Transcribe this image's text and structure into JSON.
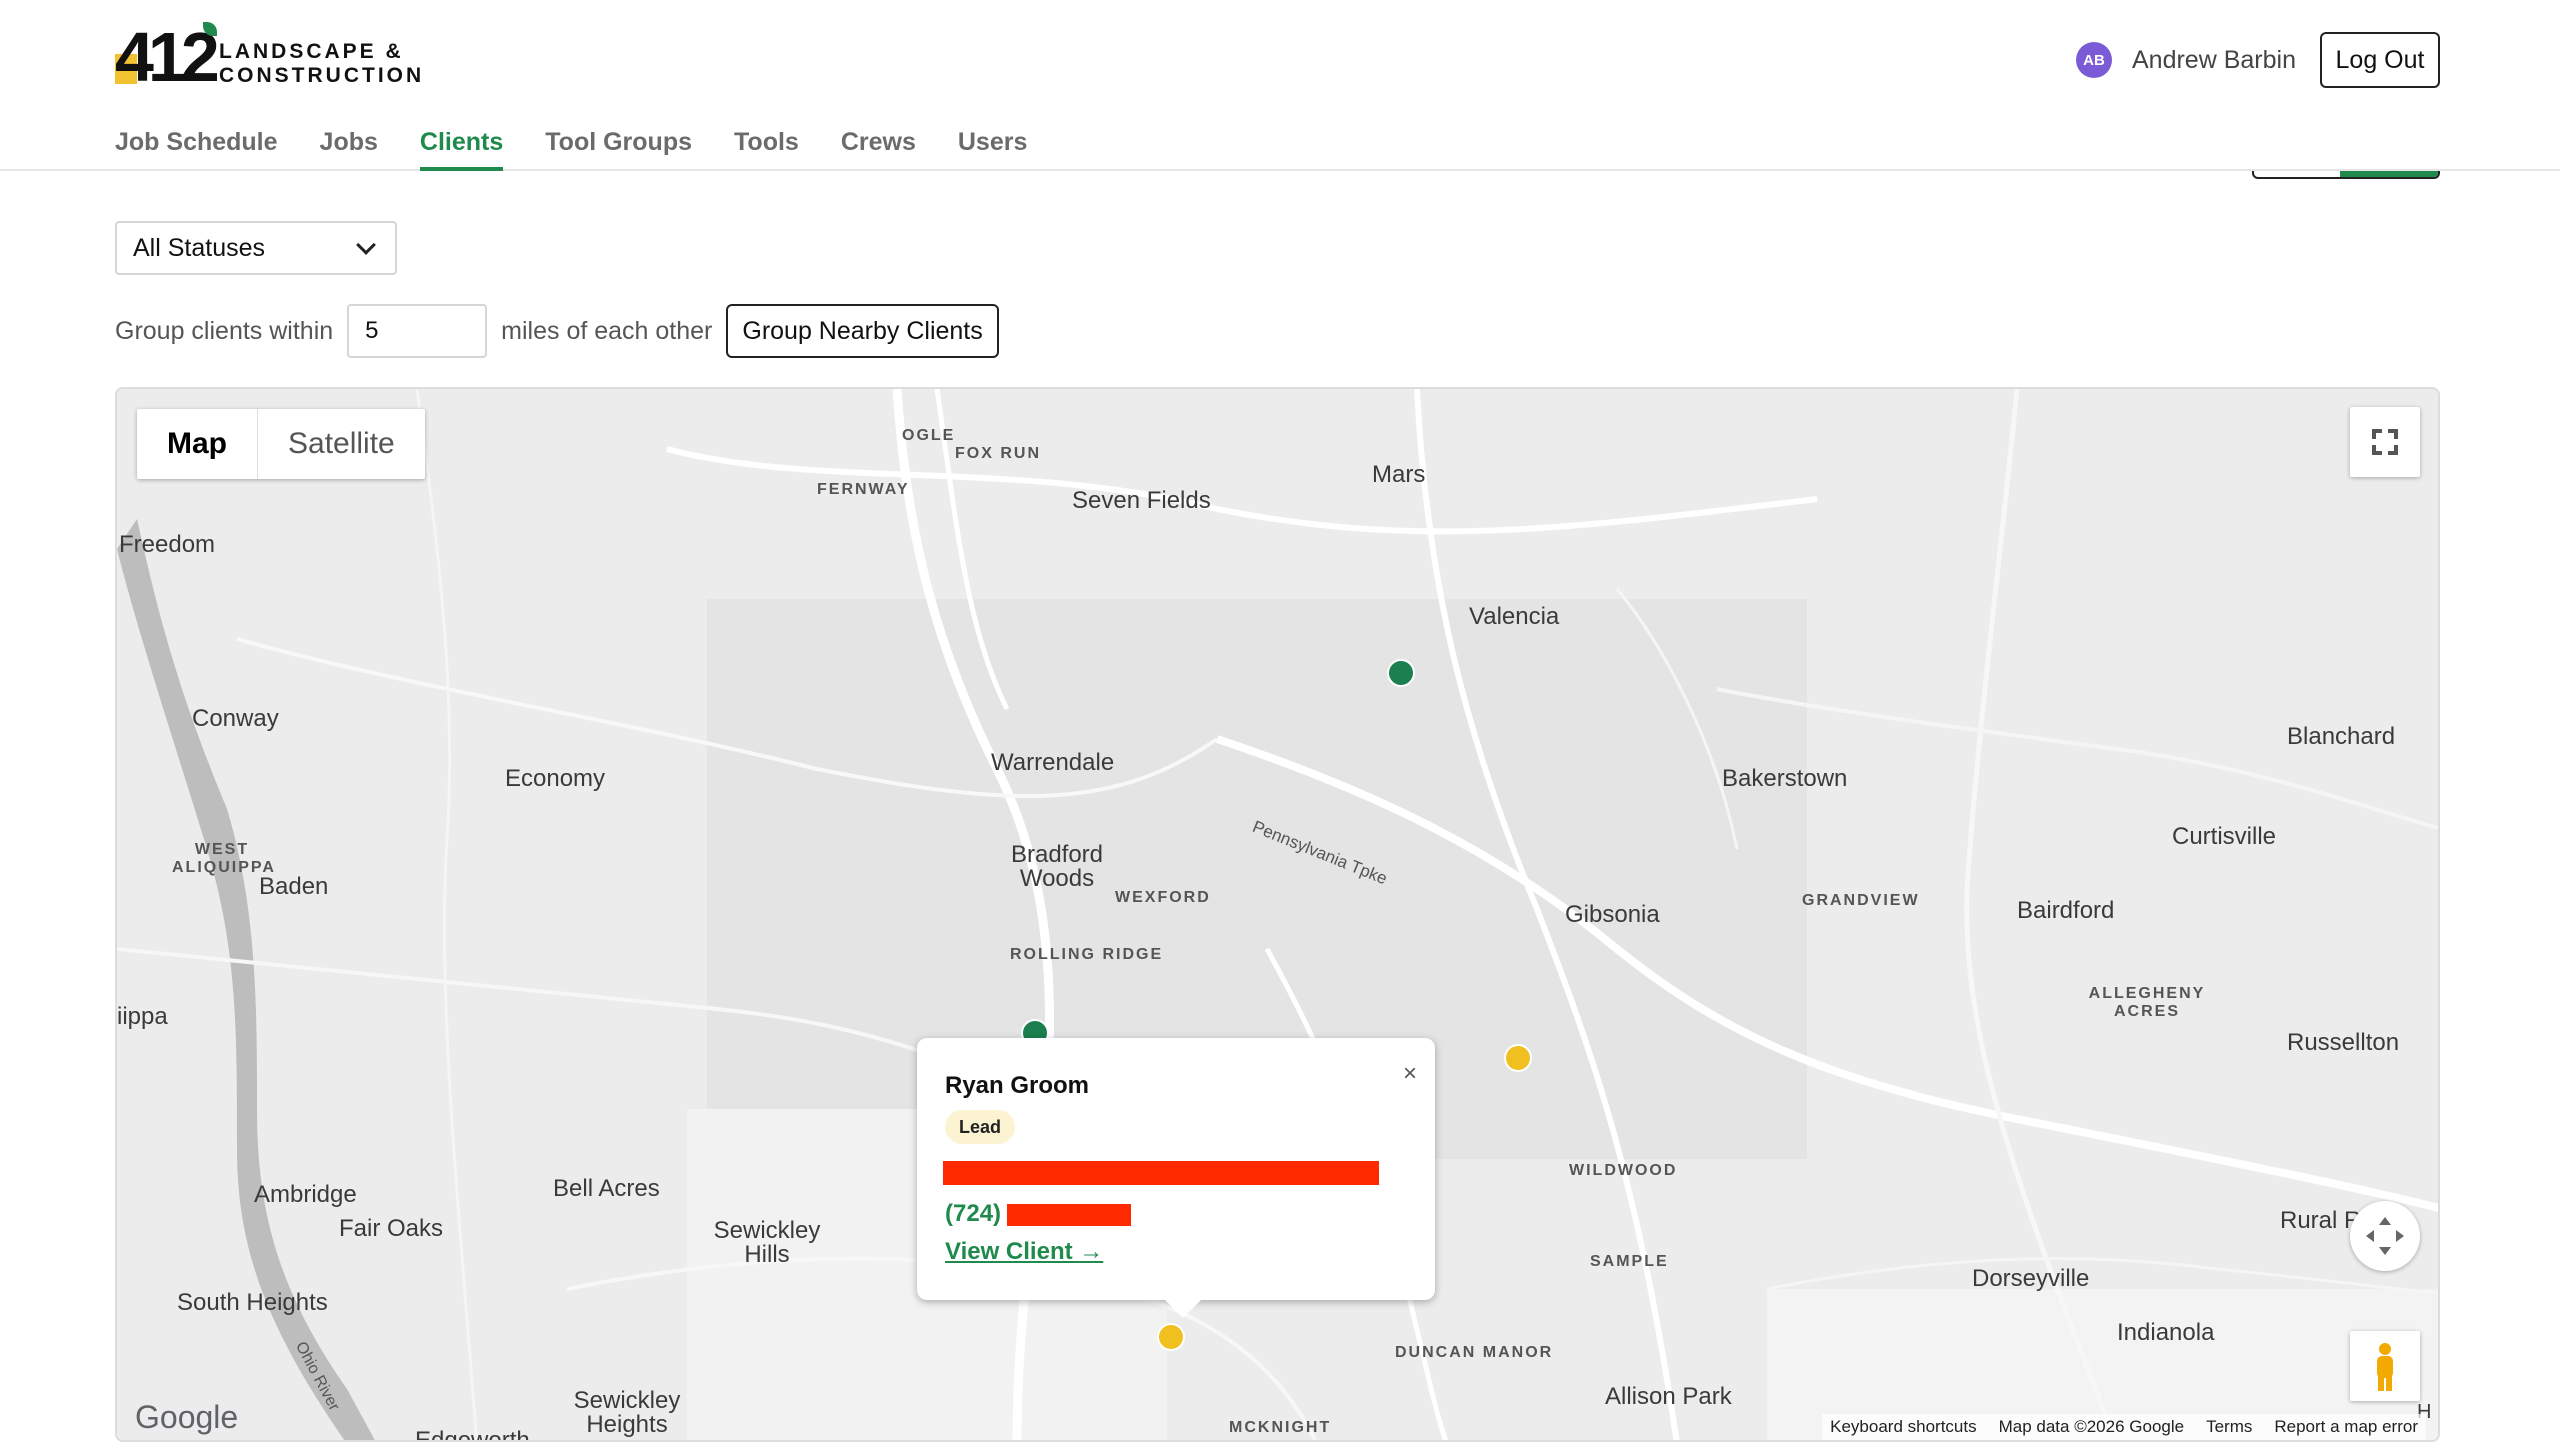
{
  "brand": {
    "number": "412",
    "line1": "LANDSCAPE &",
    "line2": "CONSTRUCTION"
  },
  "user": {
    "initials": "AB",
    "name": "Andrew Barbin",
    "logout_label": "Log Out"
  },
  "nav": {
    "items": [
      "Job Schedule",
      "Jobs",
      "Clients",
      "Tool Groups",
      "Tools",
      "Crews",
      "Users"
    ],
    "active": "Clients"
  },
  "filters": {
    "status_selected": "All Statuses",
    "group_prefix": "Group clients within",
    "group_miles": "5",
    "group_suffix": "miles of each other",
    "group_button": "Group Nearby Clients"
  },
  "map": {
    "type_map": "Map",
    "type_satellite": "Satellite",
    "labels": {
      "ogle": "OGLE",
      "fox_run": "FOX RUN",
      "fernway": "FERNWAY",
      "seven_fields": "Seven Fields",
      "mars": "Mars",
      "freedom": "Freedom",
      "valencia": "Valencia",
      "conway": "Conway",
      "economy": "Economy",
      "warrendale": "Warrendale",
      "bakerstown": "Bakerstown",
      "blanchard": "Blanchard",
      "west_aliquippa_1": "WEST",
      "west_aliquippa_2": "ALIQUIPPA",
      "baden": "Baden",
      "bradford_woods_1": "Bradford",
      "bradford_woods_2": "Woods",
      "wexford": "WEXFORD",
      "pa_tpke": "Pennsylvania Tpke",
      "gibsonia": "Gibsonia",
      "grandview": "GRANDVIEW",
      "bairdford": "Bairdford",
      "curtisville": "Curtisville",
      "rolling_ridge": "ROLLING RIDGE",
      "aliquippa_partial": "iippa",
      "allegheny_acres_1": "ALLEGHENY",
      "allegheny_acres_2": "ACRES",
      "russellton": "Russellton",
      "ambridge": "Ambridge",
      "fair_oaks": "Fair Oaks",
      "bell_acres": "Bell Acres",
      "sewickley_hills_1": "Sewickley",
      "sewickley_hills_2": "Hills",
      "wildwood": "WILDWOOD",
      "rural_ridge": "Rural Ri",
      "sample": "SAMPLE",
      "dorseyville": "Dorseyville",
      "south_heights": "South Heights",
      "ohio_river": "Ohio River",
      "duncan_manor": "DUNCAN MANOR",
      "indianola": "Indianola",
      "allison_park": "Allison Park",
      "sewickley_heights_1": "Sewickley",
      "sewickley_heights_2": "Heights",
      "edgeworth": "Edgeworth",
      "mcknight": "MCKNIGHT",
      "h_partial": "H"
    },
    "popup": {
      "name": "Ryan Groom",
      "badge": "Lead",
      "phone_prefix": "(724)",
      "link": "View Client →",
      "close": "×"
    },
    "google": "Google",
    "attribution": [
      "Keyboard shortcuts",
      "Map data ©2026 Google",
      "Terms",
      "Report a map error"
    ]
  },
  "colors": {
    "accent": "#1f8a4c",
    "marker_green": "#1b7f4f",
    "marker_yellow": "#f0c020",
    "logo_yellow": "#f2c230"
  }
}
